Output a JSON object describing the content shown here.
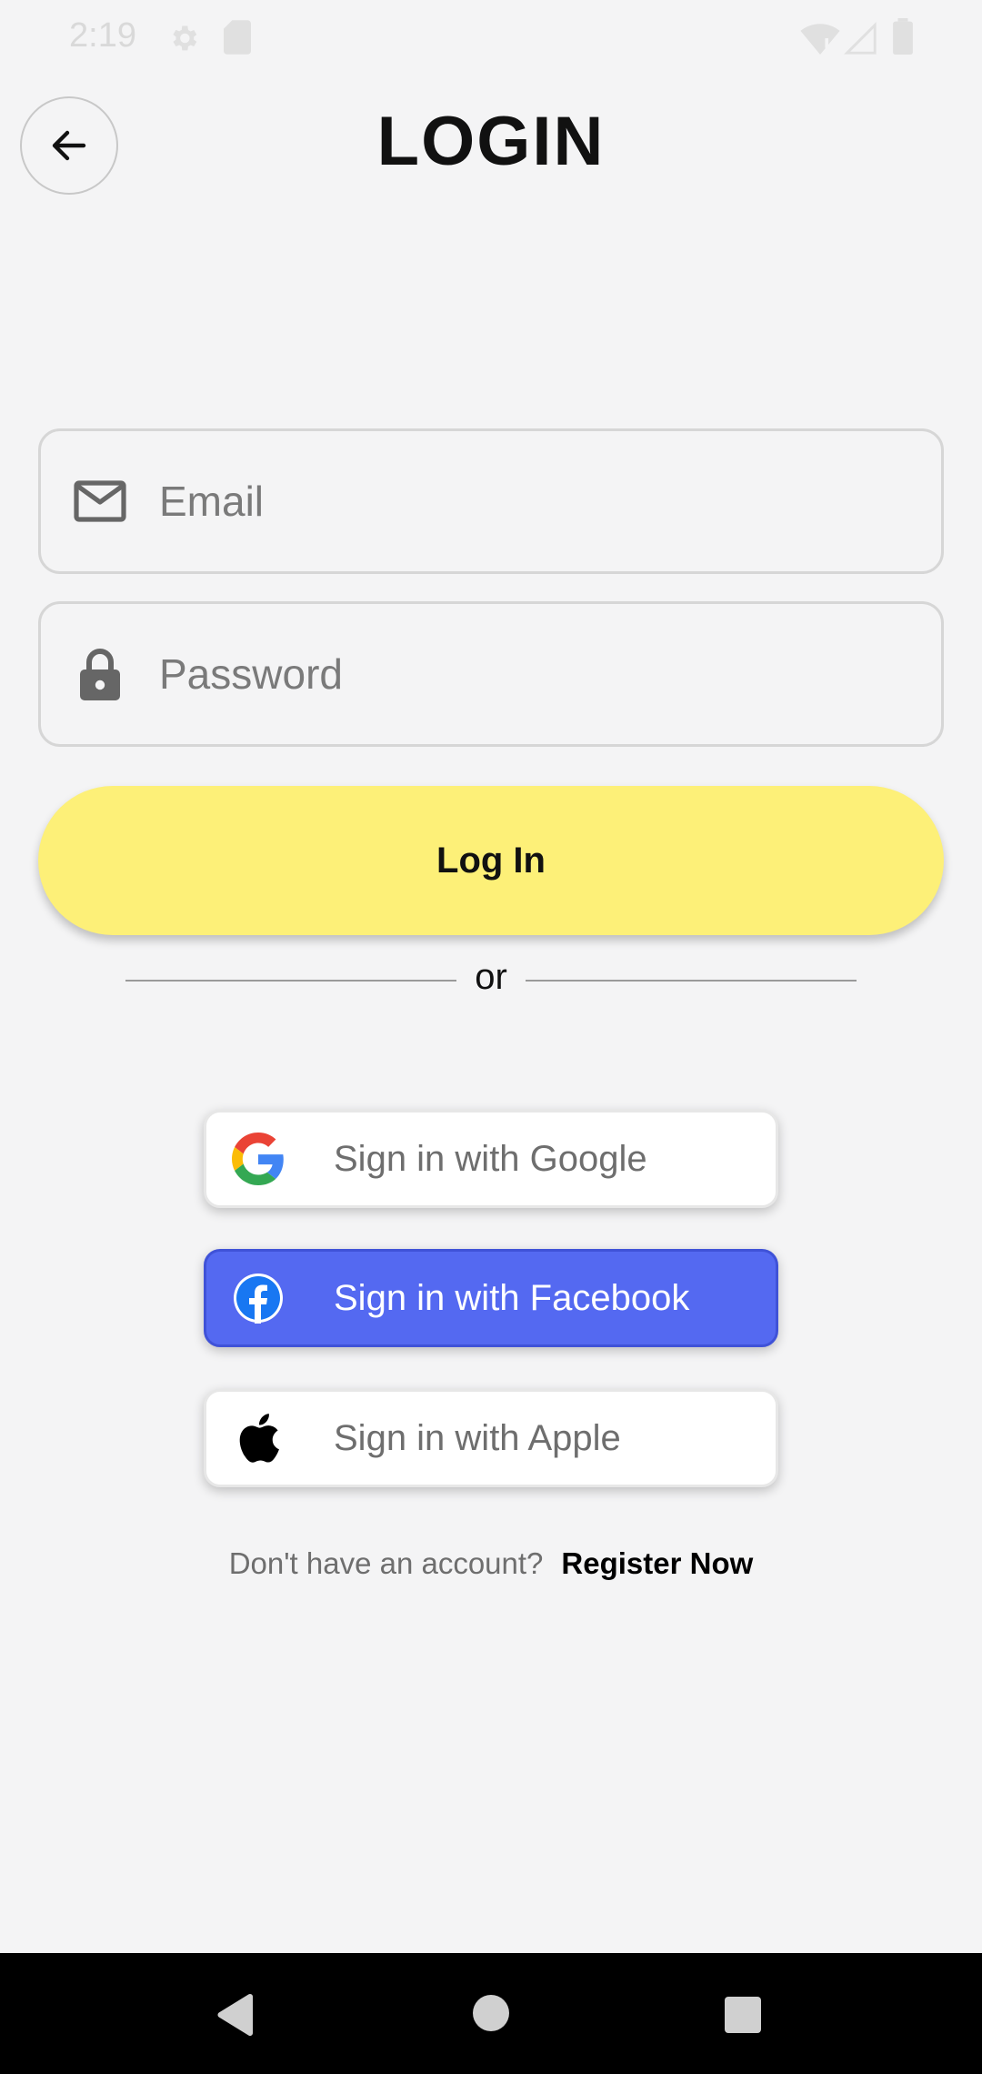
{
  "status_bar": {
    "time": "2:19"
  },
  "header": {
    "title": "LOGIN"
  },
  "form": {
    "email_placeholder": "Email",
    "password_placeholder": "Password",
    "login_label": "Log In"
  },
  "divider": {
    "text": "or"
  },
  "social": {
    "google_label": "Sign in with Google",
    "facebook_label": "Sign in with Facebook",
    "apple_label": "Sign in with Apple"
  },
  "register": {
    "prompt": "Don't have an account?",
    "link": "Register Now"
  },
  "colors": {
    "background": "#f4f4f5",
    "login_button": "#fdf078",
    "facebook_button": "#5469f1"
  }
}
